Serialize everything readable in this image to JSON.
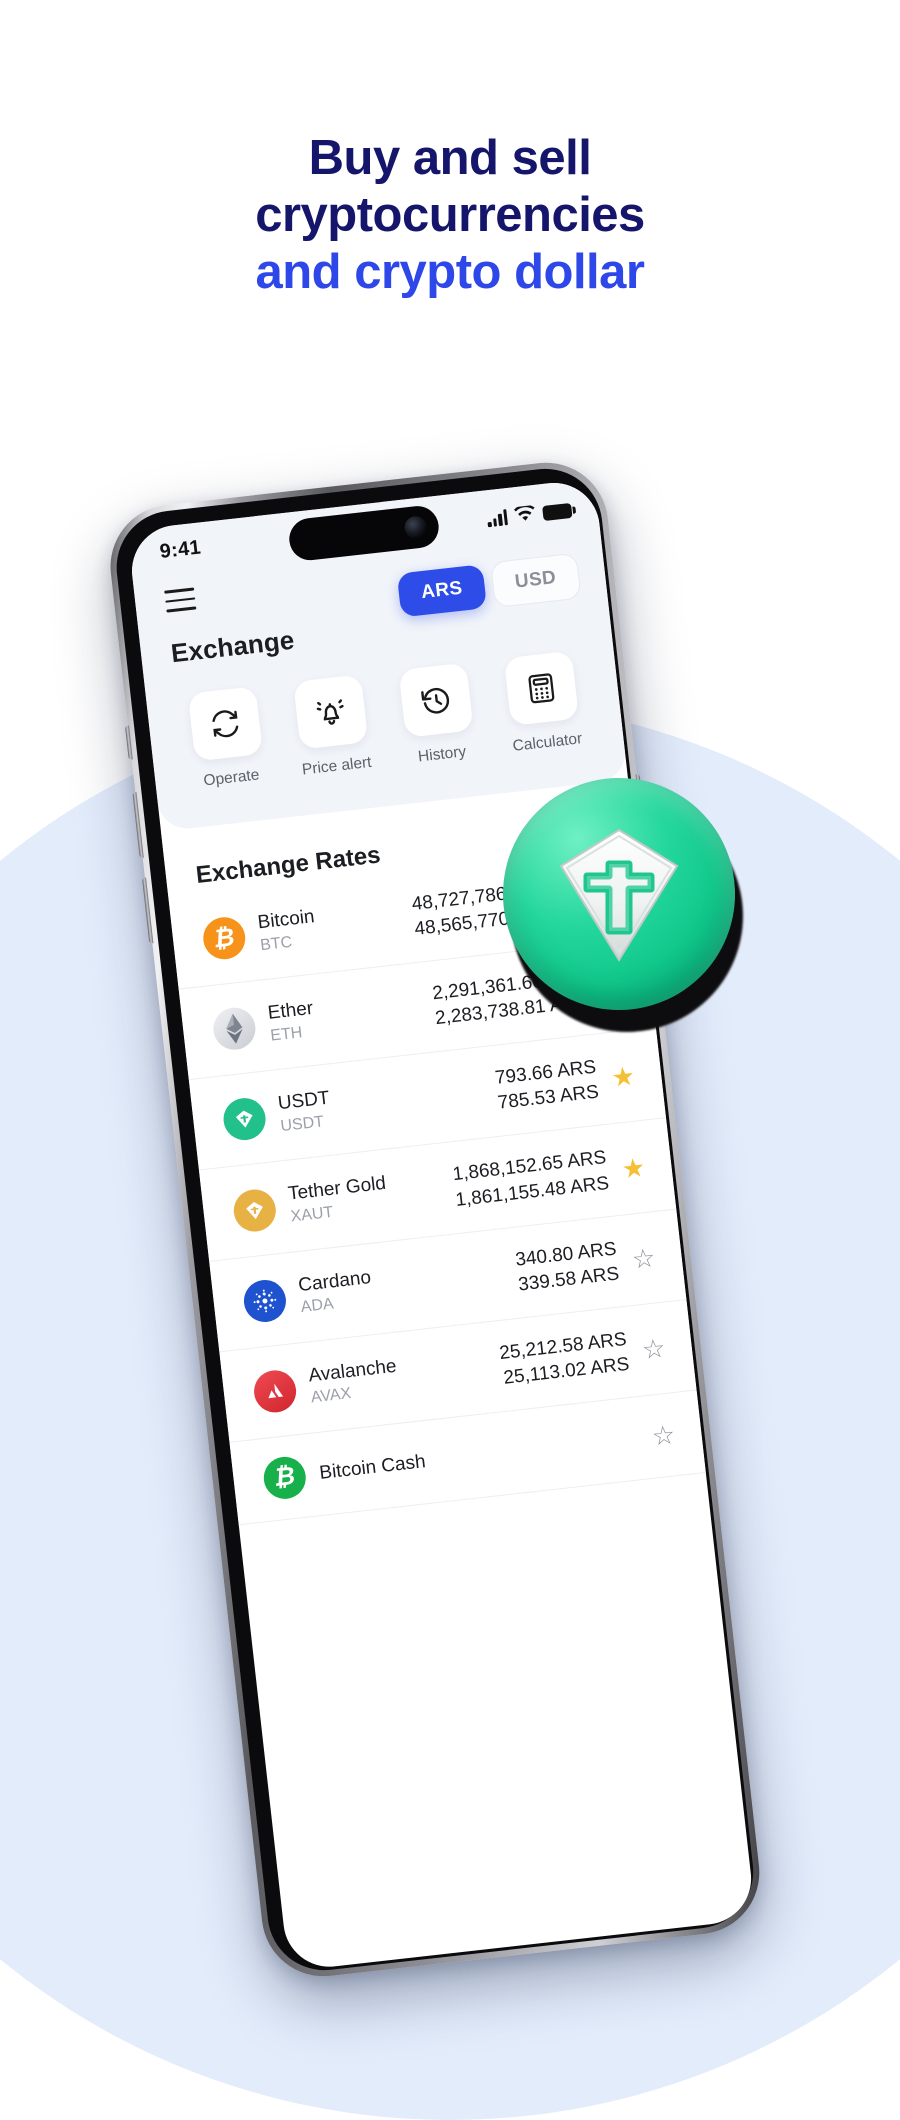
{
  "headline": {
    "line1": "Buy and sell",
    "line2": "cryptocurrencies",
    "line3": "and crypto dollar",
    "navy_color": "#15166b",
    "blue_color": "#2e47e8"
  },
  "status_bar": {
    "time": "9:41",
    "signal_icon": "cellular-signal-icon",
    "wifi_icon": "wifi-icon",
    "battery_icon": "battery-icon"
  },
  "header": {
    "menu_icon": "hamburger-menu-icon",
    "title": "Exchange",
    "currency_options": [
      {
        "label": "ARS",
        "active": true
      },
      {
        "label": "USD",
        "active": false
      }
    ]
  },
  "quick_actions": [
    {
      "label": "Operate",
      "icon": "refresh-swap-icon"
    },
    {
      "label": "Price alert",
      "icon": "bell-alert-icon"
    },
    {
      "label": "History",
      "icon": "clock-history-icon"
    },
    {
      "label": "Calculator",
      "icon": "calculator-icon"
    }
  ],
  "rates": {
    "section_title": "Exchange Rates",
    "currency_suffix": "ARS",
    "rows": [
      {
        "name": "Bitcoin",
        "symbol": "BTC",
        "buy": "48,727,786.90 ARS",
        "sell": "48,565,770.57 ARS",
        "favorite": true,
        "badge_color": "#f7931a",
        "glyph": "₿"
      },
      {
        "name": "Ether",
        "symbol": "ETH",
        "buy": "2,291,361.60 ARS",
        "sell": "2,283,738.81 ARS",
        "favorite": true,
        "badge_color": "#d7d9dd",
        "glyph": "⧫"
      },
      {
        "name": "USDT",
        "symbol": "USDT",
        "buy": "793.66 ARS",
        "sell": "785.53 ARS",
        "favorite": true,
        "badge_color": "#22c08a",
        "glyph": "₮"
      },
      {
        "name": "Tether Gold",
        "symbol": "XAUT",
        "buy": "1,868,152.65 ARS",
        "sell": "1,861,155.48 ARS",
        "favorite": true,
        "badge_color": "#e8b143",
        "glyph": "₮"
      },
      {
        "name": "Cardano",
        "symbol": "ADA",
        "buy": "340.80 ARS",
        "sell": "339.58 ARS",
        "favorite": false,
        "badge_color": "#1f52cf",
        "glyph": "⁂"
      },
      {
        "name": "Avalanche",
        "symbol": "AVAX",
        "buy": "25,212.58 ARS",
        "sell": "25,113.02 ARS",
        "favorite": false,
        "badge_color": "#e2373f",
        "glyph": "▲"
      },
      {
        "name": "Bitcoin Cash",
        "symbol": "",
        "buy": "",
        "sell": "",
        "favorite": false,
        "badge_color": "#18b04b",
        "glyph": "₿"
      }
    ],
    "star_on_glyph": "★",
    "star_off_glyph": "☆"
  },
  "floating_coin": {
    "name": "usdt-coin",
    "symbol": "₮",
    "color": "#16c98c"
  }
}
